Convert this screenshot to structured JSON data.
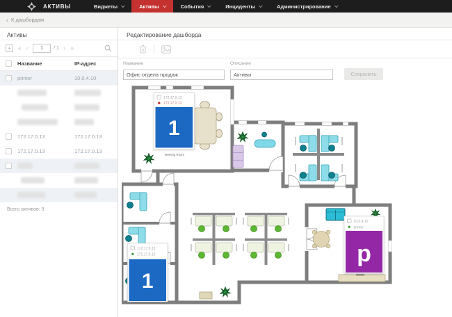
{
  "nav": {
    "brand": "АКТИВЫ",
    "items": [
      "Виджеты",
      "Активы",
      "События",
      "Инциденты",
      "Администрирование"
    ],
    "active_item": "Активы",
    "accent_color": "#c43230"
  },
  "breadcrumb": {
    "label": "К дашбордам"
  },
  "assets_panel": {
    "title": "Активы",
    "toolbar": {
      "add": "+",
      "page_value": "1",
      "page_total": "/ 1"
    },
    "columns": {
      "name": "Название",
      "ip": "IP-адрес"
    },
    "rows": [
      {
        "name": "printer",
        "ip": "10.0.4.10",
        "selected": true
      },
      {
        "redacted": true
      },
      {
        "redacted": true
      },
      {
        "redacted": true
      },
      {
        "name": "172.17.0.13",
        "ip": "172.17.0.13"
      },
      {
        "name": "172.17.0.13",
        "ip": "172.17.0.13"
      },
      {
        "redacted": true,
        "selected": true
      },
      {
        "redacted": true
      },
      {
        "redacted": true,
        "selected": true
      }
    ],
    "footer": "Всего активов: 9"
  },
  "editor_panel": {
    "title": "Редактирование дашборда",
    "form": {
      "name_label": "Название",
      "name_value": "Офис отдела продаж",
      "desc_label": "Описание",
      "desc_value": "Активы",
      "save_label": "Сохранить"
    }
  },
  "floorplan": {
    "room_label": "Meeting Room",
    "widget_meeting": {
      "row1": "172.17.0.13",
      "row2": "172.17.0.13",
      "tile": "1",
      "tile_color": "#1b69c2",
      "status_color": "#c9302c"
    },
    "widget_office": {
      "row1": "172.17.0.13",
      "row2": "172.17.0.13",
      "tile": "1",
      "tile_color": "#1b69c2",
      "status_color": "#43a047"
    },
    "widget_printer": {
      "row1": "10.0.4.10",
      "row2": "printer",
      "tile": "p",
      "tile_color": "#9327a6",
      "status_color": "#43a047"
    }
  }
}
